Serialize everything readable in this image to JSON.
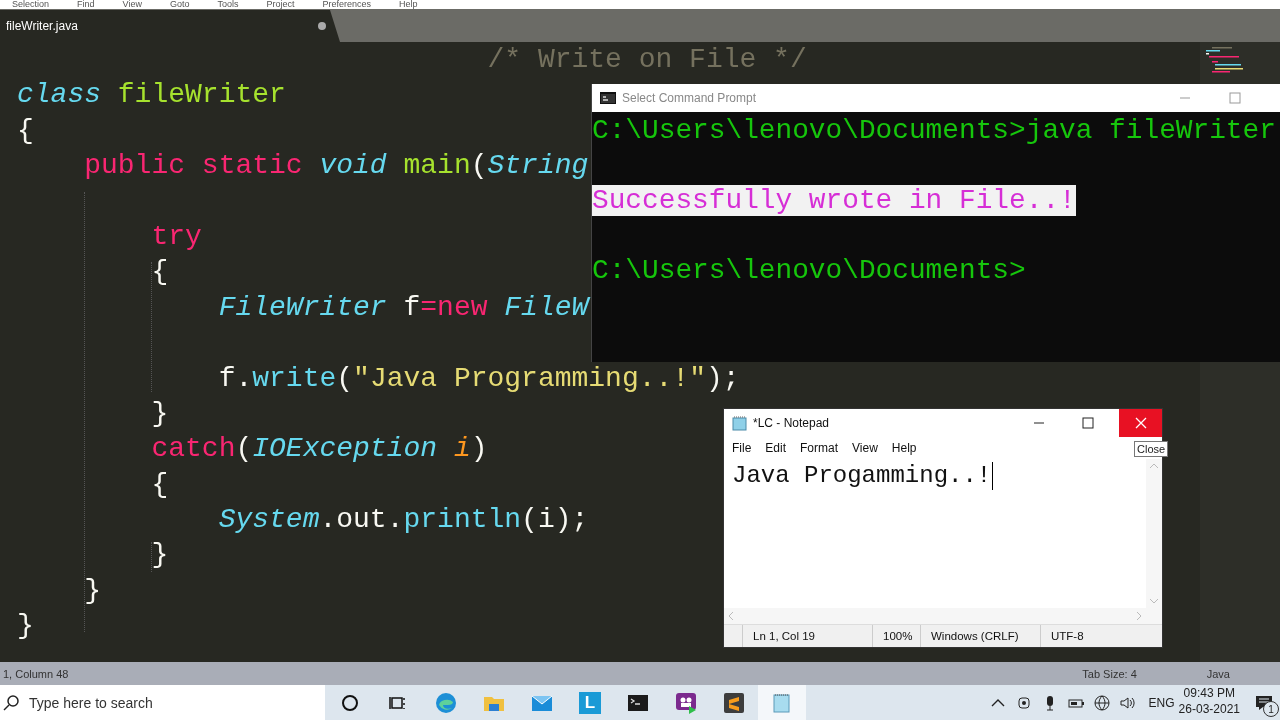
{
  "menu_bar": [
    "Selection",
    "Find",
    "View",
    "Goto",
    "Tools",
    "Project",
    "Preferences",
    "Help"
  ],
  "tabs": [
    {
      "label": "fileWriter.java",
      "selected": true,
      "modified": true
    }
  ],
  "code_lines": [
    {
      "kind": "code",
      "tokens": [
        {
          "text": "                            /* Write on File */",
          "kind": "comment"
        }
      ]
    },
    {
      "kind": "code",
      "tokens": [
        {
          "text": "class",
          "kind": "storage"
        },
        {
          "text": " fileWriter",
          "kind": "entity"
        }
      ]
    },
    {
      "kind": "code",
      "tokens": [
        {
          "text": "{",
          "kind": "plain"
        }
      ]
    },
    {
      "kind": "code",
      "tokens": [
        {
          "text": "    public static",
          "kind": "keyword"
        },
        {
          "text": " void",
          "kind": "storage"
        },
        {
          "text": " main",
          "kind": "entity"
        },
        {
          "text": "(",
          "kind": "plain"
        },
        {
          "text": "String",
          "kind": "storage"
        }
      ]
    },
    {
      "kind": "blank"
    },
    {
      "kind": "code",
      "tokens": [
        {
          "text": "        try",
          "kind": "keyword"
        }
      ]
    },
    {
      "kind": "code",
      "tokens": [
        {
          "text": "        {",
          "kind": "plain"
        }
      ]
    },
    {
      "kind": "code",
      "tokens": [
        {
          "text": "            FileWriter",
          "kind": "storage"
        },
        {
          "text": " f",
          "kind": "plain"
        },
        {
          "text": "=new",
          "kind": "keyword"
        },
        {
          "text": " FileW",
          "kind": "storage"
        }
      ]
    },
    {
      "kind": "blank"
    },
    {
      "kind": "code",
      "tokens": [
        {
          "text": "            f.",
          "kind": "plain"
        },
        {
          "text": "write",
          "kind": "support"
        },
        {
          "text": "(",
          "kind": "plain"
        },
        {
          "text": "\"Java Programming..!\"",
          "kind": "string"
        },
        {
          "text": ");",
          "kind": "plain"
        }
      ]
    },
    {
      "kind": "code",
      "tokens": [
        {
          "text": "        }",
          "kind": "plain"
        }
      ]
    },
    {
      "kind": "code",
      "tokens": [
        {
          "text": "        catch",
          "kind": "keyword"
        },
        {
          "text": "(",
          "kind": "plain"
        },
        {
          "text": "IOException",
          "kind": "storage"
        },
        {
          "text": " i",
          "kind": "param"
        },
        {
          "text": ")",
          "kind": "plain"
        }
      ]
    },
    {
      "kind": "code",
      "tokens": [
        {
          "text": "        {",
          "kind": "plain"
        }
      ]
    },
    {
      "kind": "code",
      "tokens": [
        {
          "text": "            System",
          "kind": "storage"
        },
        {
          "text": ".out.",
          "kind": "plain"
        },
        {
          "text": "println",
          "kind": "support"
        },
        {
          "text": "(i);",
          "kind": "plain"
        }
      ]
    },
    {
      "kind": "code",
      "tokens": [
        {
          "text": "        }",
          "kind": "plain"
        }
      ]
    },
    {
      "kind": "code",
      "tokens": [
        {
          "text": "    }",
          "kind": "plain"
        }
      ]
    },
    {
      "kind": "code",
      "tokens": [
        {
          "text": "}",
          "kind": "plain"
        }
      ]
    }
  ],
  "status_bar": {
    "position": "1, Column 48",
    "tab_size": "Tab Size: 4",
    "syntax": "Java"
  },
  "command_prompt": {
    "title": "Select Command Prompt",
    "lines": [
      {
        "kind": "prompt",
        "text": "C:\\Users\\lenovo\\Documents>java fileWriter",
        "selected": false
      },
      {
        "kind": "blank"
      },
      {
        "kind": "output",
        "text": "Successfully wrote in File..!",
        "selected": true
      },
      {
        "kind": "blank"
      },
      {
        "kind": "prompt",
        "text": "C:\\Users\\lenovo\\Documents>",
        "selected": false
      }
    ]
  },
  "notepad": {
    "title": "*LC - Notepad",
    "menu": [
      "File",
      "Edit",
      "Format",
      "View",
      "Help"
    ],
    "content": "Java Progamming..!",
    "tooltip": "Close",
    "status": [
      "Ln 1, Col 19",
      "100%",
      "Windows (CRLF)",
      "UTF-8"
    ]
  },
  "taskbar": {
    "search_placeholder": "Type here to search",
    "apps": [
      {
        "kind": "cortana",
        "selected": false
      },
      {
        "kind": "taskview",
        "selected": false
      },
      {
        "kind": "browser",
        "selected": false
      },
      {
        "kind": "folder",
        "selected": false
      },
      {
        "kind": "mail",
        "selected": false
      },
      {
        "kind": "letter",
        "label": "L",
        "selected": false
      },
      {
        "kind": "terminal",
        "selected": false
      },
      {
        "kind": "video",
        "selected": false
      },
      {
        "kind": "sublime",
        "selected": false
      },
      {
        "kind": "notepad",
        "selected": true
      }
    ],
    "language": "ENG",
    "time": "09:43 PM",
    "date": "26-03-2021",
    "notification_count": "1"
  }
}
